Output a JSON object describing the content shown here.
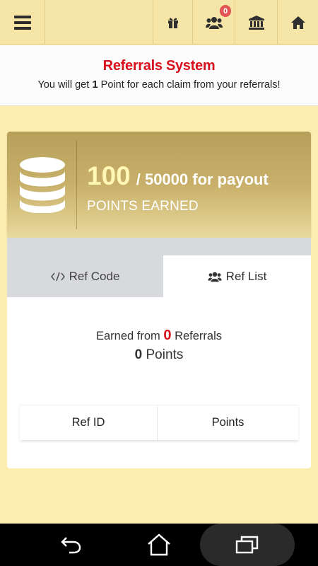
{
  "topbar": {
    "buttons": [
      {
        "name": "menu",
        "icon": "hamburger-icon"
      },
      {
        "name": "gift",
        "icon": "gift-icon"
      },
      {
        "name": "referrals",
        "icon": "users-icon",
        "badge": "0"
      },
      {
        "name": "bank",
        "icon": "bank-icon"
      },
      {
        "name": "home",
        "icon": "home-icon"
      }
    ]
  },
  "header": {
    "title": "Referrals System",
    "subtitle_pre": "You will get ",
    "subtitle_bold": "1",
    "subtitle_post": " Point for each claim from your referrals!"
  },
  "points_card": {
    "points": "100",
    "payout_text": "/ 50000 for payout",
    "label": "POINTS EARNED"
  },
  "tabs": [
    {
      "label": "Ref Code",
      "icon": "code-icon",
      "active": false
    },
    {
      "label": "Ref List",
      "icon": "users-icon",
      "active": true
    }
  ],
  "summary": {
    "earned_pre": "Earned from ",
    "referral_count": "0",
    "earned_post": " Referrals",
    "points_value": "0",
    "points_label": " Points"
  },
  "table": {
    "columns": [
      "Ref ID",
      "Points"
    ],
    "rows": []
  },
  "colors": {
    "accent_red": "#d80f1c",
    "background": "#fdeeb0",
    "card_gold": "#c8b06a",
    "badge": "#e25555"
  }
}
